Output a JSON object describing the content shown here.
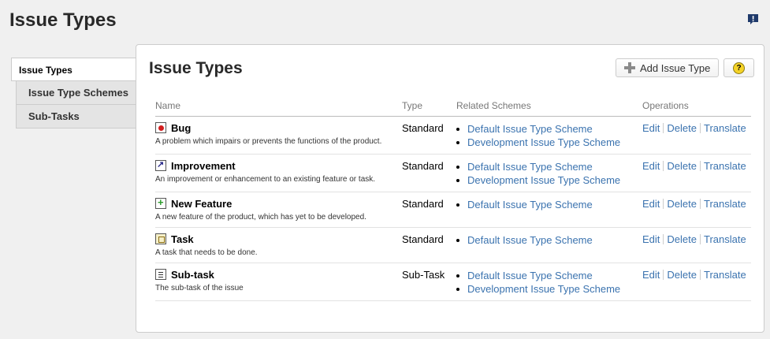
{
  "page": {
    "title": "Issue Types"
  },
  "sidebar": {
    "items": [
      {
        "label": "Issue Types",
        "selected": true
      },
      {
        "label": "Issue Type Schemes",
        "selected": false
      },
      {
        "label": "Sub-Tasks",
        "selected": false
      }
    ]
  },
  "panel": {
    "title": "Issue Types",
    "add_button": "Add Issue Type",
    "help_glyph": "?"
  },
  "table": {
    "headers": {
      "name": "Name",
      "type": "Type",
      "schemes": "Related Schemes",
      "operations": "Operations"
    },
    "ops": {
      "edit": "Edit",
      "delete": "Delete",
      "translate": "Translate"
    },
    "rows": [
      {
        "icon": "bug-icon",
        "name": "Bug",
        "description": "A problem which impairs or prevents the functions of the product.",
        "type": "Standard",
        "schemes": [
          "Default Issue Type Scheme",
          "Development Issue Type Scheme"
        ]
      },
      {
        "icon": "improvement-icon",
        "name": "Improvement",
        "description": "An improvement or enhancement to an existing feature or task.",
        "type": "Standard",
        "schemes": [
          "Default Issue Type Scheme",
          "Development Issue Type Scheme"
        ]
      },
      {
        "icon": "new-feature-icon",
        "name": "New Feature",
        "description": "A new feature of the product, which has yet to be developed.",
        "type": "Standard",
        "schemes": [
          "Default Issue Type Scheme"
        ]
      },
      {
        "icon": "task-icon",
        "name": "Task",
        "description": "A task that needs to be done.",
        "type": "Standard",
        "schemes": [
          "Default Issue Type Scheme"
        ]
      },
      {
        "icon": "subtask-icon",
        "name": "Sub-task",
        "description": "The sub-task of the issue",
        "type": "Sub-Task",
        "schemes": [
          "Default Issue Type Scheme",
          "Development Issue Type Scheme"
        ]
      }
    ]
  },
  "colors": {
    "link": "#3b73af",
    "feedback": "#1f3a6b",
    "help": "#f5d327"
  }
}
